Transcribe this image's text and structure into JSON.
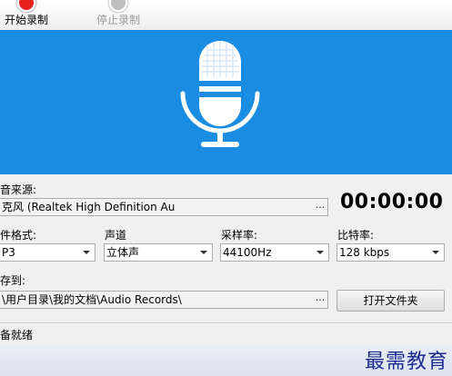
{
  "toolbar": {
    "start_label": "开始录制",
    "stop_label": "停止录制"
  },
  "colors": {
    "banner": "#1a8de3",
    "record_red": "#e8231f"
  },
  "icons": {
    "banner": "microphone-icon",
    "start": "record-icon",
    "stop": "stop-icon"
  },
  "source": {
    "label": "音来源:",
    "value": "克风 (Realtek High Definition Au",
    "browse": "..."
  },
  "timer": "00:00:00",
  "format": {
    "label": "件格式:",
    "value": "P3"
  },
  "channel": {
    "label": "声道",
    "value": "立体声"
  },
  "samplerate": {
    "label": "采样率:",
    "value": "44100Hz"
  },
  "bitrate": {
    "label": "比特率:",
    "value": "128 kbps"
  },
  "save": {
    "label": "存到:",
    "path": "\\用户目录\\我的文档\\Audio Records\\",
    "browse": "...",
    "open_folder": "打开文件夹"
  },
  "status": "备就绪",
  "watermark": "最需教育"
}
